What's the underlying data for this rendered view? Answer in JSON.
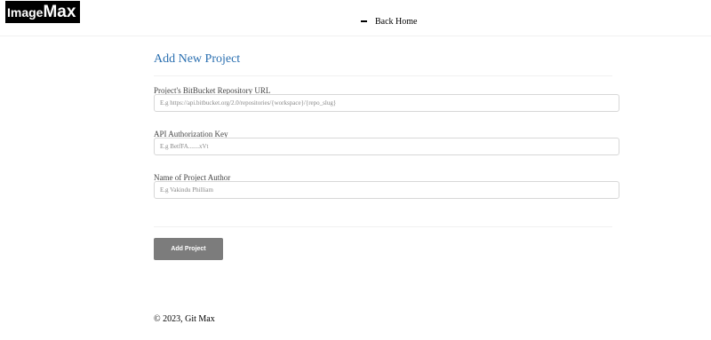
{
  "header": {
    "logo_part1": "Image",
    "logo_part2": "Max",
    "back_home_label": "Back Home"
  },
  "form": {
    "title": "Add New Project",
    "fields": [
      {
        "label": "Project's BitBucket Repository URL",
        "value": "",
        "placeholder": "E.g https://api.bitbucket.org/2.0/repositories/{workspace}/{repo_slug}"
      },
      {
        "label": "API Authorization Key",
        "value": "",
        "placeholder": "E.g BetfFA.......xVt"
      },
      {
        "label": "Name of Project Author",
        "value": "",
        "placeholder": "E.g Vakindu Philliam"
      }
    ],
    "submit_label": "Add Project"
  },
  "footer": {
    "copyright": "© 2023, Git Max"
  }
}
